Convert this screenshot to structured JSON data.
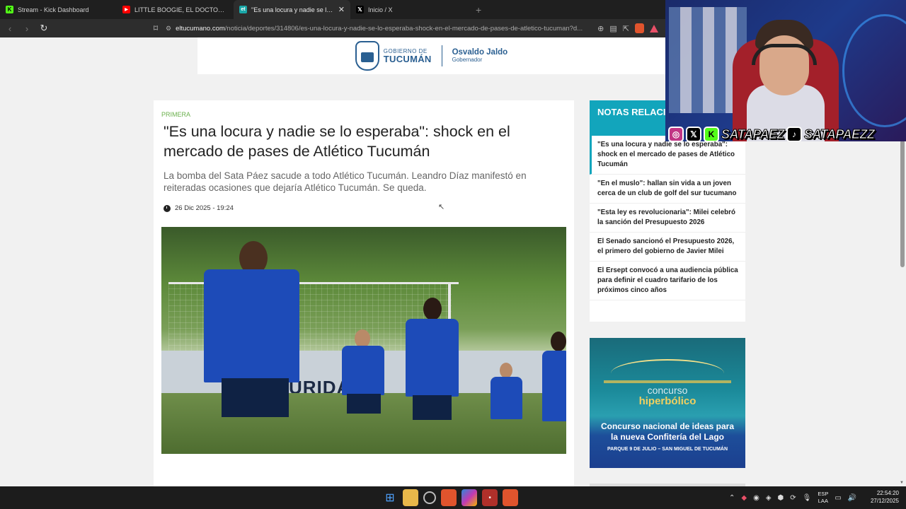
{
  "browser": {
    "tabs": [
      {
        "title": "Stream - Kick Dashboard",
        "icon": "kick-icon",
        "color": "#53fc18",
        "active": false
      },
      {
        "title": "LITTLE BOOGIE, EL DOCTOR & RUSH",
        "icon": "youtube-icon",
        "color": "#ff0000",
        "active": false
      },
      {
        "title": "\"Es una locura y nadie se lo espe",
        "icon": "eltucumano-icon",
        "color": "#1aa7a8",
        "active": true
      },
      {
        "title": "Inicio / X",
        "icon": "x-icon",
        "color": "#000000",
        "active": false
      }
    ],
    "url_host": "eltucumano.com",
    "url_path": "/noticia/deportes/314806/es-una-locura-y-nadie-se-lo-esperaba-shock-en-el-mercado-de-pases-de-atletico-tucuman?d..."
  },
  "gov_banner": {
    "small": "GOBIERNO DE",
    "big": "TUCUMÁN",
    "name": "Osvaldo Jaldo",
    "role": "Gobernador"
  },
  "article": {
    "kicker": "PRIMERA",
    "headline": "\"Es una locura y nadie se lo esperaba\": shock en el mercado de pases de Atlético Tucumán",
    "subhead": "La bomba del Sata Páez sacude a todo Atlético Tucumán. Leandro Díaz manifestó en reiteradas ocasiones que dejaría Atlético Tucumán. Se queda.",
    "date": "26 Dic 2025 - 19:24",
    "photo_wall_text": "URIDAD"
  },
  "sidebar": {
    "title": "NOTAS RELACIO",
    "items": [
      "\"Es una locura y nadie se lo esperaba\": shock en el mercado de pases de Atlético Tucumán",
      "\"En el muslo\": hallan sin vida a un joven cerca de un club de golf del sur tucumano",
      "\"Esta ley es revolucionaria\": Milei celebró la sanción del Presupuesto 2026",
      "El Senado sancionó el Presupuesto 2026, el primero del gobierno de Javier Milei",
      "El Ersept convocó a una audiencia pública para definir el cuadro tarifario de los próximos cinco años"
    ]
  },
  "ad": {
    "line1": "concurso",
    "line2": "hiperbólico",
    "line3": "Concurso nacional de ideas para la nueva Confitería del Lago",
    "line4": "PARQUE 9 DE JULIO – SAN MIGUEL DE TUCUMÁN"
  },
  "stream_overlay": {
    "handle1": "SATAPAEZ",
    "handle2": "SATAPAEZZ"
  },
  "taskbar": {
    "lang_top": "ESP",
    "lang_bottom": "LAA",
    "time": "22:54:20",
    "date": "27/12/2025"
  }
}
